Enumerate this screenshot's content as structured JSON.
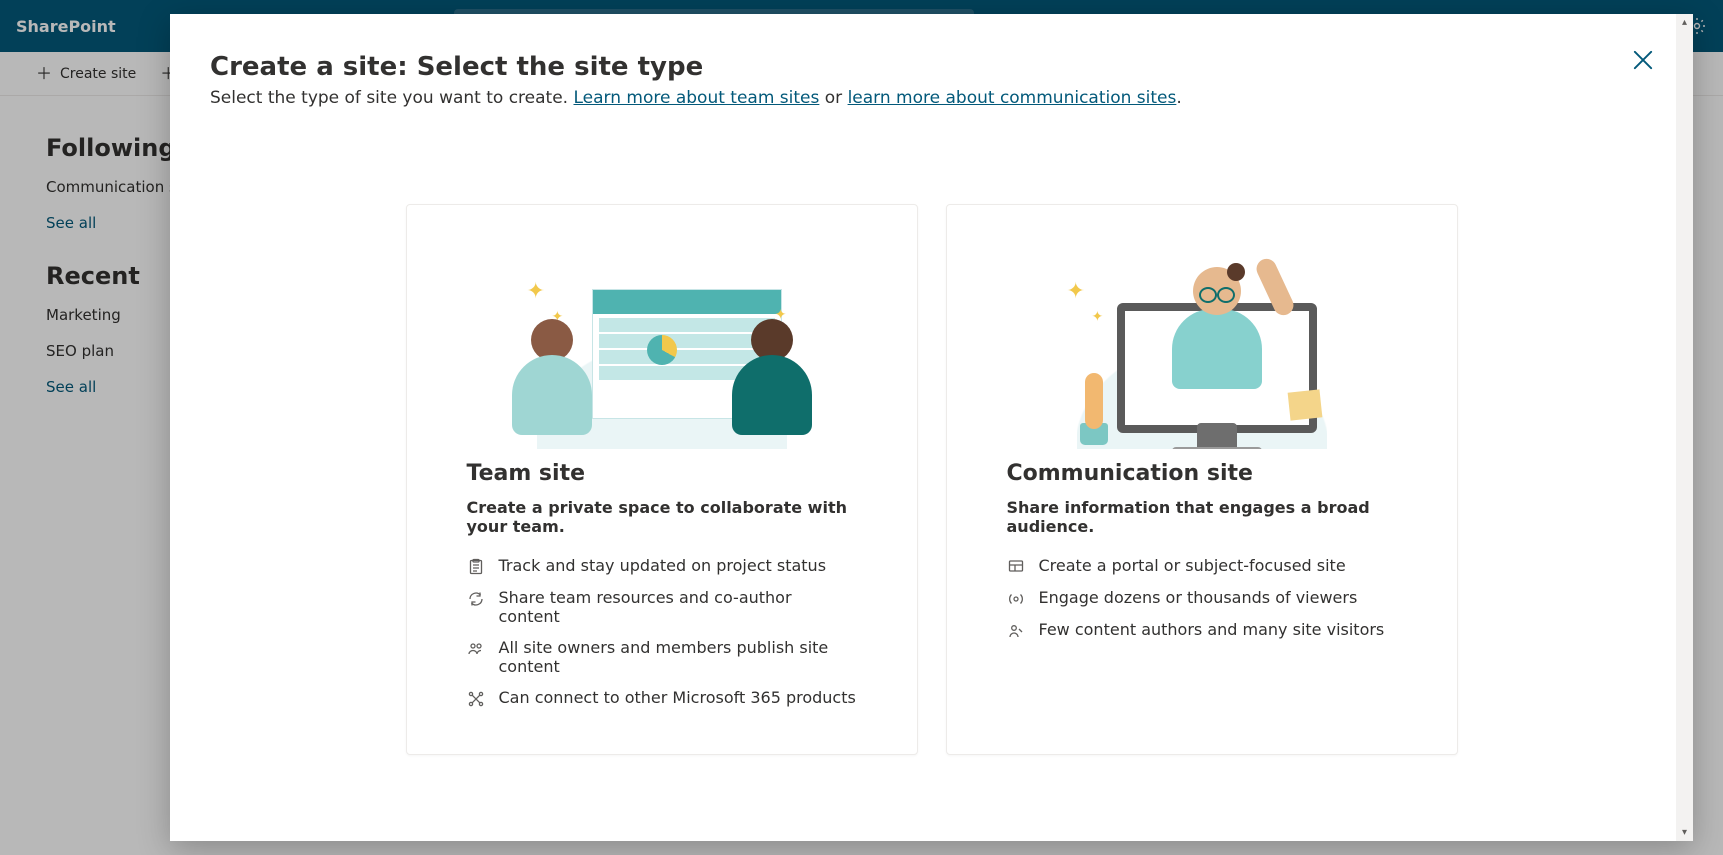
{
  "suite": {
    "brand": "SharePoint"
  },
  "commandbar": {
    "create_site": "Create site"
  },
  "sidebar": {
    "following_heading": "Following",
    "following_items": [
      "Communication s"
    ],
    "see_all": "See all",
    "recent_heading": "Recent",
    "recent_items": [
      "Marketing",
      "SEO plan"
    ]
  },
  "dialog": {
    "title": "Create a site: Select the site type",
    "subtitle_prefix": "Select the type of site you want to create. ",
    "link_team": "Learn more about team sites",
    "subtitle_mid": " or ",
    "link_comm": "learn more about communication sites",
    "subtitle_suffix": ".",
    "team_card": {
      "title": "Team site",
      "tagline": "Create a private space to collaborate with your team.",
      "bullets": [
        "Track and stay updated on project status",
        "Share team resources and co-author content",
        "All site owners and members publish site content",
        "Can connect to other Microsoft 365 products"
      ]
    },
    "comm_card": {
      "title": "Communication site",
      "tagline": "Share information that engages a broad audience.",
      "bullets": [
        "Create a portal or subject-focused site",
        "Engage dozens or thousands of viewers",
        "Few content authors and many site visitors"
      ]
    }
  }
}
